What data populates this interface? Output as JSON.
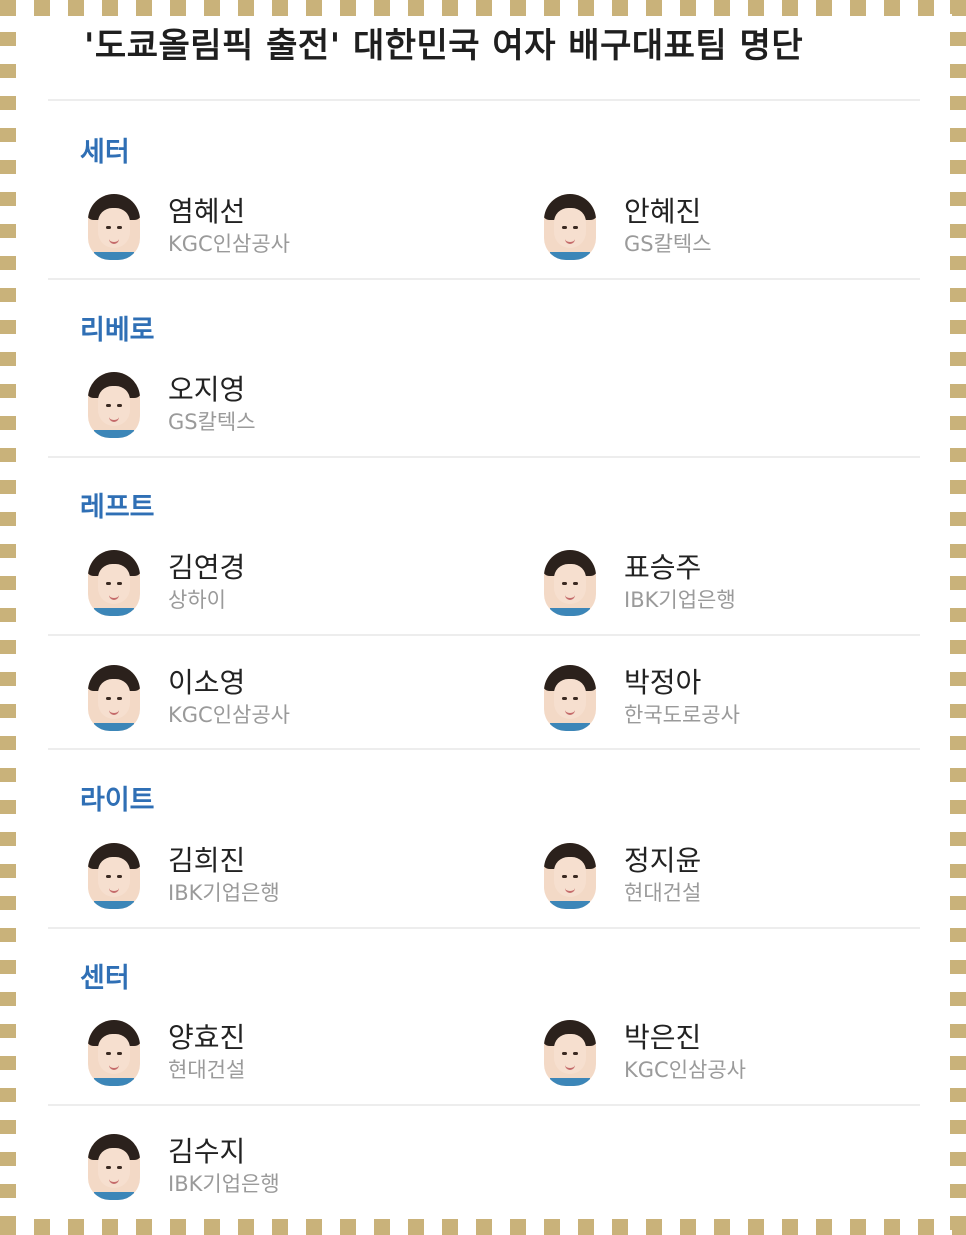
{
  "title": "'도쿄올림픽 출전' 대한민국 여자 배구대표팀 명단",
  "sections": [
    {
      "title": "세터",
      "players": [
        {
          "name": "염혜선",
          "team": "KGC인삼공사"
        },
        {
          "name": "안혜진",
          "team": "GS칼텍스"
        }
      ]
    },
    {
      "title": "리베로",
      "players": [
        {
          "name": "오지영",
          "team": "GS칼텍스"
        }
      ]
    },
    {
      "title": "레프트",
      "players": [
        {
          "name": "김연경",
          "team": "상하이"
        },
        {
          "name": "표승주",
          "team": "IBK기업은행"
        },
        {
          "name": "이소영",
          "team": "KGC인삼공사"
        },
        {
          "name": "박정아",
          "team": "한국도로공사"
        }
      ]
    },
    {
      "title": "라이트",
      "players": [
        {
          "name": "김희진",
          "team": "IBK기업은행"
        },
        {
          "name": "정지윤",
          "team": "현대건설"
        }
      ]
    },
    {
      "title": "센터",
      "players": [
        {
          "name": "양효진",
          "team": "현대건설"
        },
        {
          "name": "박은진",
          "team": "KGC인삼공사"
        },
        {
          "name": "김수지",
          "team": "IBK기업은행"
        }
      ]
    }
  ],
  "colors": {
    "section_title": "#2f6fb5",
    "frame": "#c9b27a",
    "team_text": "#9a9a9a"
  }
}
